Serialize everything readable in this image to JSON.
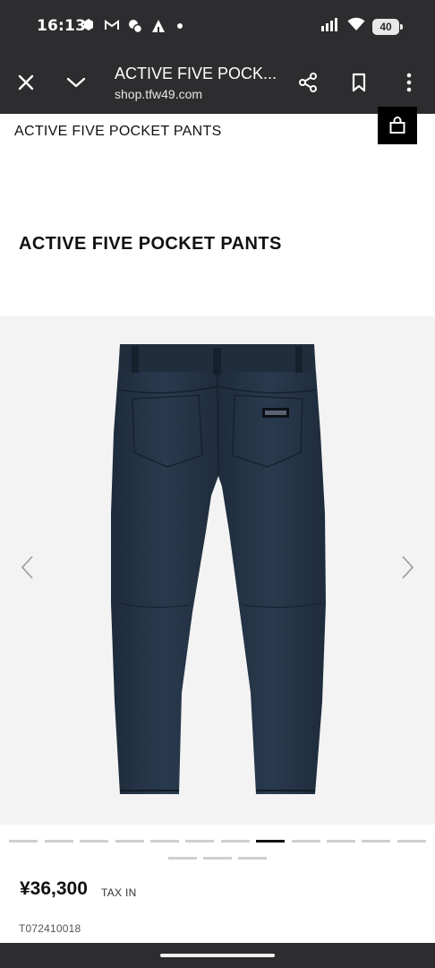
{
  "status_bar": {
    "time": "16:13",
    "battery": "40",
    "left_icons": [
      "notification-icon",
      "gmail-icon",
      "messenger-icon",
      "tent-icon",
      "dot-icon"
    ],
    "right_icons": [
      "signal-icon",
      "wifi-icon",
      "battery-icon"
    ]
  },
  "browser": {
    "title": "ACTIVE FIVE POCK...",
    "url": "shop.tfw49.com",
    "icons": [
      "close-icon",
      "chevron-down-icon",
      "share-icon",
      "bookmark-icon",
      "more-icon"
    ]
  },
  "header": {
    "sticky_title": "ACTIVE FIVE POCKET PANTS",
    "cart_icon": "shopping-bag-icon"
  },
  "product": {
    "title": "ACTIVE FIVE POCKET PANTS",
    "price": "¥36,300",
    "tax_label": "TAX IN",
    "sku": "T072410018",
    "image_color": "#26364a",
    "gallery": {
      "total_images": 15,
      "active_index": 7
    }
  },
  "colors": {
    "system_bar": "#2d2d2f",
    "accent": "#000000",
    "image_bg": "#f3f3f3"
  }
}
